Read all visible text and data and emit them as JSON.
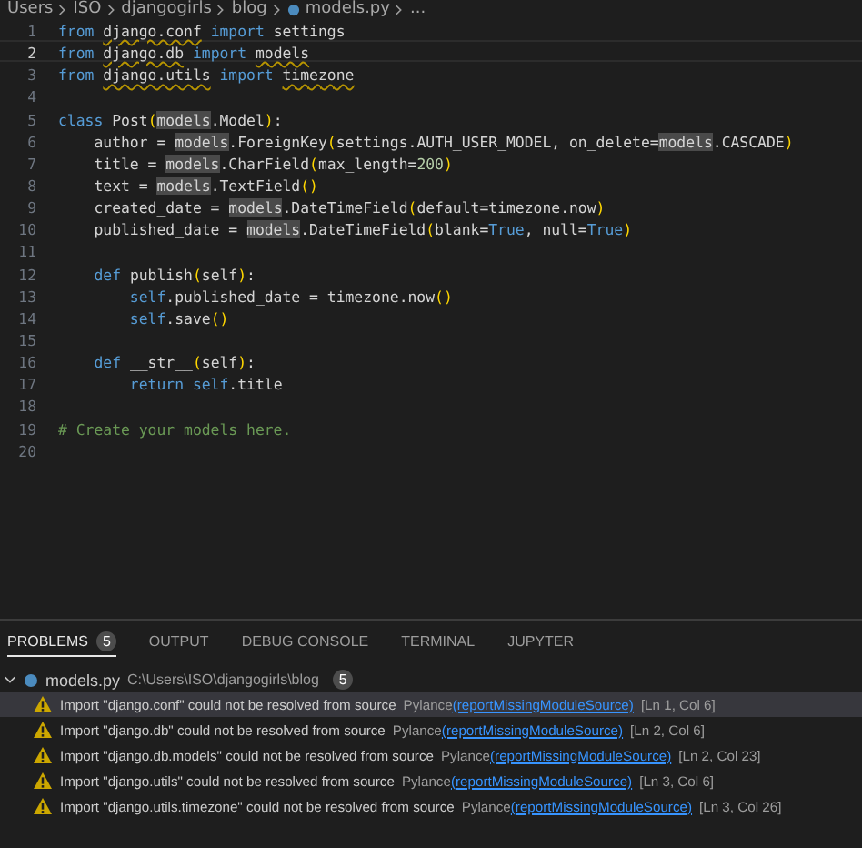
{
  "breadcrumb": [
    "Users",
    "ISO",
    "djangogirls",
    "blog",
    "models.py",
    "..."
  ],
  "editor": {
    "lines": [
      {
        "number": "1",
        "current": false,
        "tokens": [
          {
            "text": "from ",
            "kind": "keyword"
          },
          {
            "text": "django.conf",
            "kind": "warn"
          },
          {
            "text": " import ",
            "kind": "keyword"
          },
          {
            "text": "settings",
            "kind": "plain"
          }
        ]
      },
      {
        "number": "2",
        "current": true,
        "tokens": [
          {
            "text": "from ",
            "kind": "keyword"
          },
          {
            "text": "django.db",
            "kind": "warn"
          },
          {
            "text": " import ",
            "kind": "keyword"
          },
          {
            "text": "models",
            "kind": "warn"
          }
        ]
      },
      {
        "number": "3",
        "current": false,
        "tokens": [
          {
            "text": "from ",
            "kind": "keyword"
          },
          {
            "text": "django.utils",
            "kind": "warn"
          },
          {
            "text": " import ",
            "kind": "keyword"
          },
          {
            "text": "timezone",
            "kind": "warn"
          }
        ]
      },
      {
        "number": "4",
        "current": false
      },
      {
        "number": "5",
        "current": false,
        "tokens": [
          {
            "text": "class",
            "kind": "keyword"
          },
          {
            "text": " Post",
            "kind": "plain"
          },
          {
            "text": "(",
            "kind": "paren"
          },
          {
            "text": "models",
            "kind": "highlight"
          },
          {
            "text": ".Model",
            "kind": "plain"
          },
          {
            "text": ")",
            "kind": "paren"
          },
          {
            "text": ":",
            "kind": "plain"
          }
        ]
      },
      {
        "number": "6",
        "current": false,
        "tokens": [
          {
            "text": "    author = ",
            "kind": "plain"
          },
          {
            "text": "models",
            "kind": "highlight"
          },
          {
            "text": ".ForeignKey",
            "kind": "plain"
          },
          {
            "text": "(",
            "kind": "paren"
          },
          {
            "text": "settings.AUTH_USER_MODEL, on_delete=",
            "kind": "plain"
          },
          {
            "text": "models",
            "kind": "highlight"
          },
          {
            "text": ".CASCADE",
            "kind": "plain"
          },
          {
            "text": ")",
            "kind": "paren"
          }
        ]
      },
      {
        "number": "7",
        "current": false,
        "tokens": [
          {
            "text": "    title = ",
            "kind": "plain"
          },
          {
            "text": "models",
            "kind": "highlight"
          },
          {
            "text": ".CharField",
            "kind": "plain"
          },
          {
            "text": "(",
            "kind": "paren"
          },
          {
            "text": "max_length=",
            "kind": "plain"
          },
          {
            "text": "200",
            "kind": "number"
          },
          {
            "text": ")",
            "kind": "paren"
          }
        ]
      },
      {
        "number": "8",
        "current": false,
        "tokens": [
          {
            "text": "    text = ",
            "kind": "plain"
          },
          {
            "text": "models",
            "kind": "highlight"
          },
          {
            "text": ".TextField",
            "kind": "plain"
          },
          {
            "text": "()",
            "kind": "paren"
          }
        ]
      },
      {
        "number": "9",
        "current": false,
        "tokens": [
          {
            "text": "    created_date = ",
            "kind": "plain"
          },
          {
            "text": "models",
            "kind": "highlight"
          },
          {
            "text": ".DateTimeField",
            "kind": "plain"
          },
          {
            "text": "(",
            "kind": "paren"
          },
          {
            "text": "default=timezone.now",
            "kind": "plain"
          },
          {
            "text": ")",
            "kind": "paren"
          }
        ]
      },
      {
        "number": "10",
        "current": false,
        "tokens": [
          {
            "text": "    published_date = ",
            "kind": "plain"
          },
          {
            "text": "models",
            "kind": "highlight"
          },
          {
            "text": ".DateTimeField",
            "kind": "plain"
          },
          {
            "text": "(",
            "kind": "paren"
          },
          {
            "text": "blank=",
            "kind": "plain"
          },
          {
            "text": "True",
            "kind": "keyword"
          },
          {
            "text": ", null=",
            "kind": "plain"
          },
          {
            "text": "True",
            "kind": "keyword"
          },
          {
            "text": ")",
            "kind": "paren"
          }
        ]
      },
      {
        "number": "11",
        "current": false
      },
      {
        "number": "12",
        "current": false,
        "tokens": [
          {
            "text": "    def",
            "kind": "keyword"
          },
          {
            "text": " publish",
            "kind": "plain"
          },
          {
            "text": "(",
            "kind": "paren"
          },
          {
            "text": "self",
            "kind": "plain"
          },
          {
            "text": ")",
            "kind": "paren"
          },
          {
            "text": ":",
            "kind": "plain"
          }
        ]
      },
      {
        "number": "13",
        "current": false,
        "tokens": [
          {
            "text": "        self",
            "kind": "keyword"
          },
          {
            "text": ".published_date = timezone.now",
            "kind": "plain"
          },
          {
            "text": "()",
            "kind": "paren"
          }
        ]
      },
      {
        "number": "14",
        "current": false,
        "tokens": [
          {
            "text": "        self",
            "kind": "keyword"
          },
          {
            "text": ".save",
            "kind": "plain"
          },
          {
            "text": "()",
            "kind": "paren"
          }
        ]
      },
      {
        "number": "15",
        "current": false
      },
      {
        "number": "16",
        "current": false,
        "tokens": [
          {
            "text": "    def",
            "kind": "keyword"
          },
          {
            "text": " __str__",
            "kind": "plain"
          },
          {
            "text": "(",
            "kind": "paren"
          },
          {
            "text": "self",
            "kind": "plain"
          },
          {
            "text": ")",
            "kind": "paren"
          },
          {
            "text": ":",
            "kind": "plain"
          }
        ]
      },
      {
        "number": "17",
        "current": false,
        "tokens": [
          {
            "text": "        return self",
            "kind": "keyword"
          },
          {
            "text": ".title",
            "kind": "plain"
          }
        ]
      },
      {
        "number": "18",
        "current": false
      },
      {
        "number": "19",
        "current": false,
        "tokens": [
          {
            "text": "# Create your models here.",
            "kind": "comment"
          }
        ]
      },
      {
        "number": "20",
        "current": false
      }
    ]
  },
  "panel": {
    "tabs": [
      {
        "label": "PROBLEMS",
        "badge": "5",
        "selected": true
      },
      {
        "label": "OUTPUT",
        "selected": false
      },
      {
        "label": "DEBUG CONSOLE",
        "selected": false
      },
      {
        "label": "TERMINAL",
        "selected": false
      },
      {
        "label": "JUPYTER",
        "selected": false
      }
    ],
    "file": {
      "name": "models.py",
      "path": "C:\\Users\\ISO\\djangogirls\\blog",
      "count": "5",
      "expanded": true
    },
    "problems": [
      {
        "message": "Import \"django.conf\" could not be resolved from source",
        "source": "Pylance",
        "code": "(reportMissingModuleSource)",
        "location": "[Ln 1, Col 6]",
        "selected": true
      },
      {
        "message": "Import \"django.db\" could not be resolved from source",
        "source": "Pylance",
        "code": "(reportMissingModuleSource)",
        "location": "[Ln 2, Col 6]",
        "selected": false
      },
      {
        "message": "Import \"django.db.models\" could not be resolved from source",
        "source": "Pylance",
        "code": "(reportMissingModuleSource)",
        "location": "[Ln 2, Col 23]",
        "selected": false
      },
      {
        "message": "Import \"django.utils\" could not be resolved from source",
        "source": "Pylance",
        "code": "(reportMissingModuleSource)",
        "location": "[Ln 3, Col 6]",
        "selected": false
      },
      {
        "message": "Import \"django.utils.timezone\" could not be resolved from source",
        "source": "Pylance",
        "code": "(reportMissingModuleSource)",
        "location": "[Ln 3, Col 26]",
        "selected": false
      }
    ]
  }
}
